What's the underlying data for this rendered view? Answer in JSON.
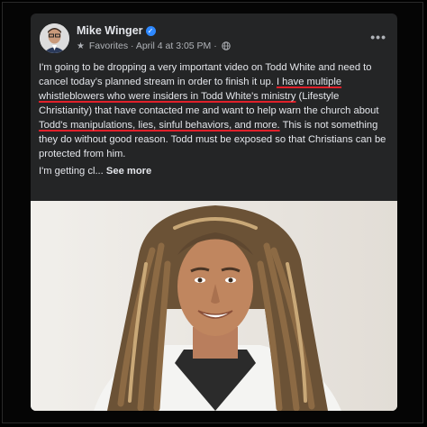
{
  "post": {
    "author": "Mike Winger",
    "audience": "Favorites",
    "separator": "·",
    "date": "April 4 at 3:05 PM",
    "more_icon": "ellipsis-icon",
    "paragraph_1_before": "I'm going to be dropping a very important video on Todd White and need to cancel today's planned stream in order to finish it up. ",
    "highlight_1": "I have multiple whistleblowers who were insiders in Todd White's ministry",
    "paragraph_1_middle": " (Lifestyle Christianity) that have contacted me and want to help warn the church about ",
    "highlight_2": "Todd's manipulations, lies, sinful behaviors, and more.",
    "paragraph_1_after": " This is not something they do without good reason. Todd must be exposed so that Christians can be protected from him.",
    "truncated_text": "I'm getting cl...",
    "see_more": "See more"
  },
  "colors": {
    "card_bg": "#242526",
    "text": "#e4e6eb",
    "secondary_text": "#b0b3b8",
    "highlight_underline": "#e0202a",
    "verified_badge": "#2d88ff"
  }
}
